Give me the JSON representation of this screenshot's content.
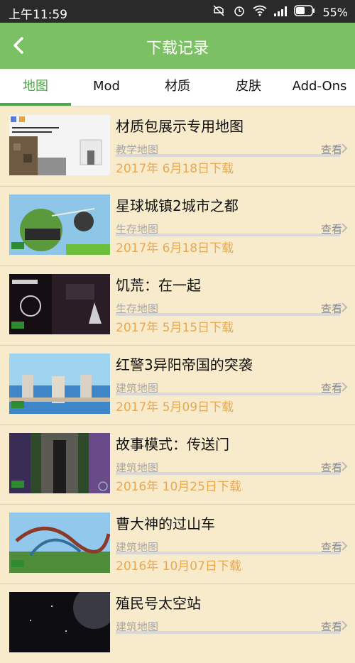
{
  "status": {
    "time": "上午11:59",
    "battery": "55%"
  },
  "header": {
    "title": "下载记录"
  },
  "tabs": [
    {
      "label": "地图",
      "active": true
    },
    {
      "label": "Mod"
    },
    {
      "label": "材质"
    },
    {
      "label": "皮肤"
    },
    {
      "label": "Add-Ons"
    }
  ],
  "items": [
    {
      "title": "材质包展示专用地图",
      "category": "教学地图",
      "view": "查看",
      "date": "2017年 6月18日下载"
    },
    {
      "title": "星球城镇2城市之都",
      "category": "生存地图",
      "view": "查看",
      "date": "2017年 6月18日下载"
    },
    {
      "title": "饥荒：在一起",
      "category": "生存地图",
      "view": "查看",
      "date": "2017年 5月15日下载"
    },
    {
      "title": "红警3异阳帝国的突袭",
      "category": "建筑地图",
      "view": "查看",
      "date": "2017年 5月09日下载"
    },
    {
      "title": "故事模式：传送门",
      "category": "建筑地图",
      "view": "查看",
      "date": "2016年 10月25日下载"
    },
    {
      "title": "曹大神的过山车",
      "category": "建筑地图",
      "view": "查看",
      "date": "2016年 10月07日下载"
    },
    {
      "title": "殖民号太空站",
      "category": "建筑地图",
      "view": "查看",
      "date": ""
    }
  ],
  "colors": {
    "header": "#7cc064",
    "tabActive": "#4fa84a",
    "date": "#e7a84f",
    "bg": "#f8ebcb"
  }
}
